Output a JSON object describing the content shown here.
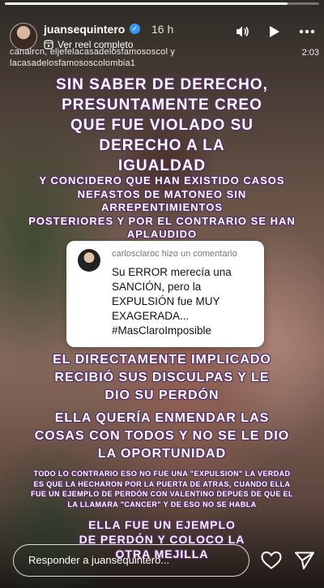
{
  "progress": 0.9,
  "header": {
    "username": "juansequintero",
    "verified_icon": "verified-badge-icon",
    "time_ago": "16 h",
    "reel_link": "Ver reel completo",
    "reel_icon": "reel-icon",
    "icons": [
      "volume-icon",
      "play-icon",
      "more-icon"
    ]
  },
  "tagline": {
    "line1": "canalrcn, eljefelacasadelosfamososcol y",
    "line2": "lacasadelosfamososcolombia1"
  },
  "duration": "2:03",
  "story_text": {
    "heading_line1": "SIN SABER DE DERECHO,",
    "heading_line2": "PRESUNTAMENTE CREO",
    "heading_line3": "QUE FUE VIOLADO SU",
    "heading_line4": "DERECHO A LA",
    "heading_line5": "IGUALDAD",
    "sub_line1": "Y CONCIDERO QUE HAN EXISTIDO CASOS",
    "sub_line2": "NEFASTOS DE MATONEO SIN ARREPENTIMIENTOS",
    "sub_line3": "POSTERIORES Y POR EL CONTRARIO SE HAN",
    "sub_line4": "APLAUDIDO",
    "mid_line1": "EL DIRECTAMENTE IMPLICADO",
    "mid_line2": "RECIBIÓ SUS DISCULPAS Y LE",
    "mid_line3": "DIO SU PERDÓN",
    "mid2_line1": "ELLA QUERÍA ENMENDAR LAS",
    "mid2_line2": "COSAS CON TODOS Y NO SE LE DIO",
    "mid2_line3": "LA OPORTUNIDAD",
    "small_line1": "TODO LO CONTRARIO ESO NO FUE UNA \"EXPULSION\" LA VERDAD",
    "small_line2": "ES QUE LA HECHARON POR LA PUERTA DE ATRAS, CUANDO ELLA",
    "small_line3": "FUE UN EJEMPLO DE PERDÓN CON VALENTINO DEPUES DE QUE EL",
    "small_line4": "LA LLAMARA \"CANCER\" Y DE ESO NO SE HABLA",
    "end_line1": "ELLA FUE UN EJEMPLO",
    "end_line2": "DE PERDÓN Y COLOCO LA",
    "end_line3": "OTRA MEJILLA"
  },
  "comment": {
    "header": "carlosclaroc hizo un comentario",
    "body_line1": "Su ERROR merecía una",
    "body_line2": "SANCIÓN, pero la",
    "body_line3": "EXPULSIÓN fue MUY",
    "body_line4": "EXAGERADA...",
    "body_line5": "#MasClaroImposible"
  },
  "footer": {
    "reply_placeholder": "Responder a juansequintero...",
    "icons": [
      "heart-icon",
      "send-icon"
    ]
  }
}
